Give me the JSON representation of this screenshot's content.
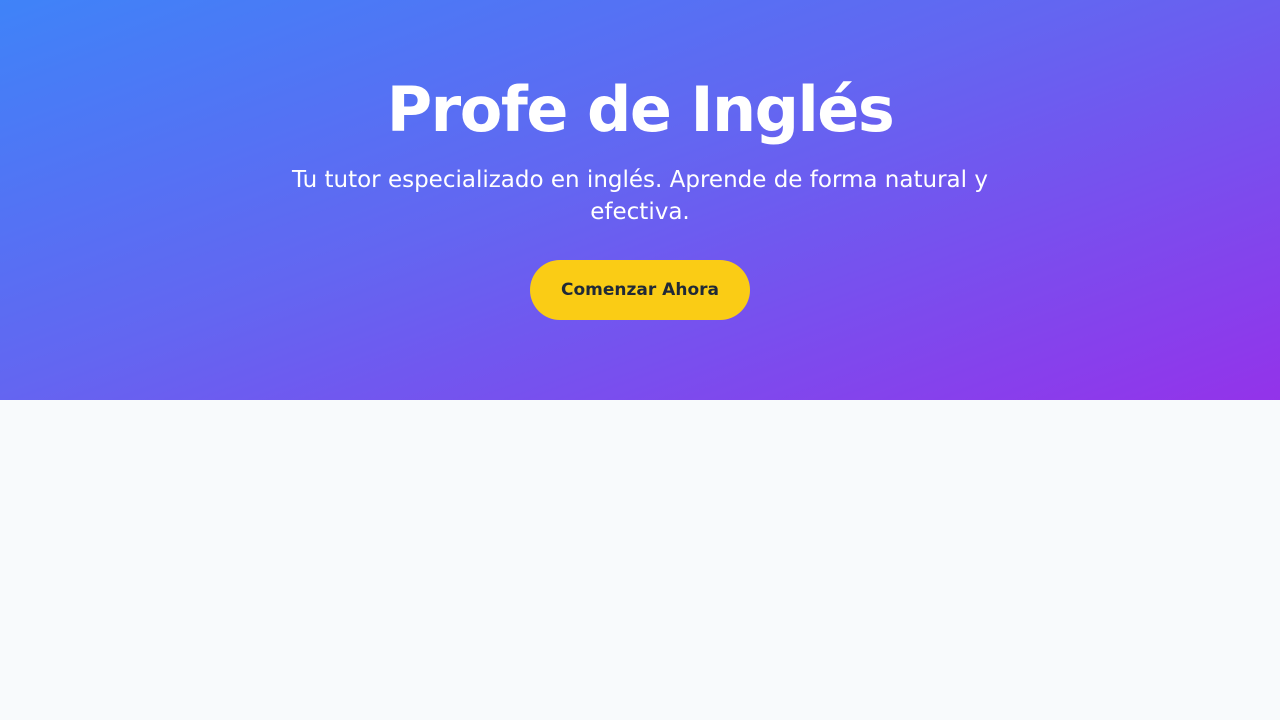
{
  "hero": {
    "title": "Profe de Inglés",
    "subtitle": "Tu tutor especializado en inglés. Aprende de forma natural y efectiva.",
    "cta_label": "Comenzar Ahora"
  },
  "colors": {
    "gradient_start": "#3f83f8",
    "gradient_mid": "#6366f1",
    "gradient_end": "#9333ea",
    "cta_background": "#facc15",
    "cta_text": "#1f2937",
    "page_background": "#f8fafc"
  }
}
